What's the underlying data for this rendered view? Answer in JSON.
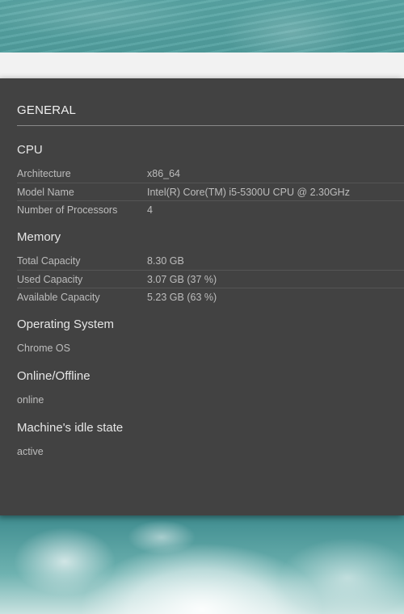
{
  "header": {
    "section_title": "GENERAL"
  },
  "cpu": {
    "title": "CPU",
    "rows": [
      {
        "key": "Architecture",
        "value": "x86_64"
      },
      {
        "key": "Model Name",
        "value": "Intel(R) Core(TM) i5-5300U CPU @ 2.30GHz"
      },
      {
        "key": "Number of Processors",
        "value": "4"
      }
    ]
  },
  "memory": {
    "title": "Memory",
    "rows": [
      {
        "key": "Total Capacity",
        "value": "8.30 GB"
      },
      {
        "key": "Used Capacity",
        "value": "3.07 GB (37 %)"
      },
      {
        "key": "Available Capacity",
        "value": "5.23 GB (63 %)"
      }
    ]
  },
  "os": {
    "title": "Operating System",
    "value": "Chrome OS"
  },
  "network": {
    "title": "Online/Offline",
    "value": "online"
  },
  "idle": {
    "title": "Machine's idle state",
    "value": "active"
  },
  "colors": {
    "panel_bg": "#424242",
    "header_strip": "#f2f2f2",
    "text_primary": "#e6e6e6",
    "text_secondary": "#bdbdbd"
  }
}
